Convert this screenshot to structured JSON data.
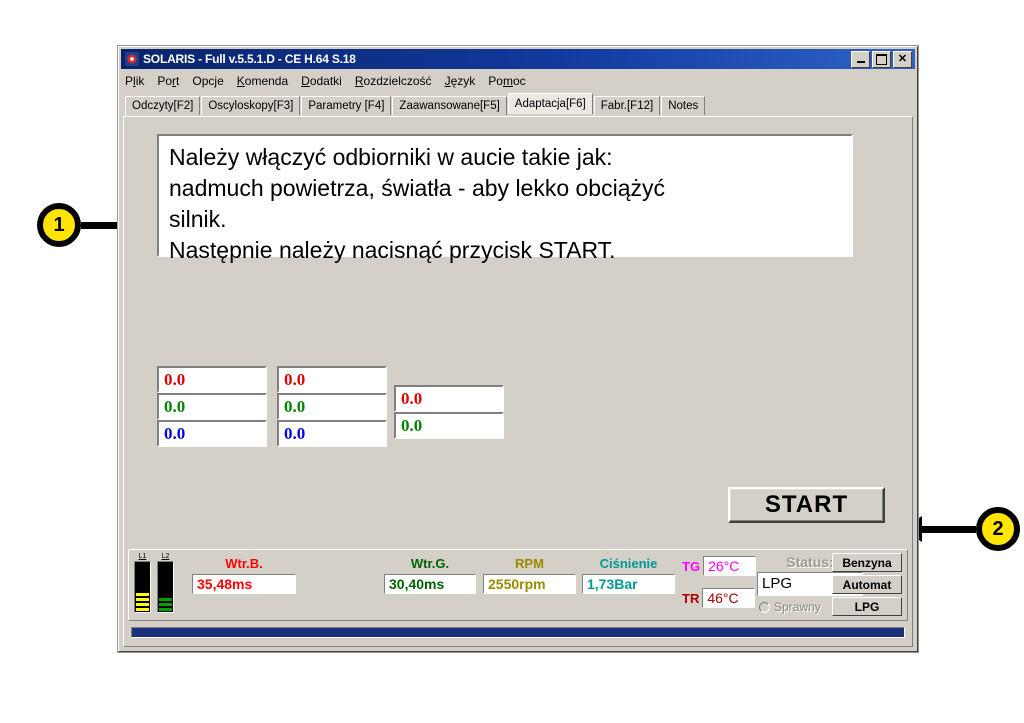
{
  "window": {
    "title": "SOLARIS - Full v.5.5.1.D - CE H.64 S.18",
    "icon": "solaris-app-icon",
    "controls": {
      "minimize": "minimize-icon",
      "maximize": "maximize-icon",
      "close": "close-icon"
    }
  },
  "menu": {
    "items": [
      {
        "pre": "P",
        "accel": "l",
        "post": "ik"
      },
      {
        "pre": "Po",
        "accel": "r",
        "post": "t"
      },
      {
        "pre": "Opc",
        "accel": "j",
        "post": "e"
      },
      {
        "pre": "",
        "accel": "K",
        "post": "omenda"
      },
      {
        "pre": "",
        "accel": "D",
        "post": "odatki"
      },
      {
        "pre": "",
        "accel": "R",
        "post": "ozdzielczość"
      },
      {
        "pre": "",
        "accel": "J",
        "post": "ęzyk"
      },
      {
        "pre": "Po",
        "accel": "m",
        "post": "oc"
      }
    ]
  },
  "tabs": {
    "items": [
      {
        "label": "Odczyty[F2]",
        "active": false
      },
      {
        "label": "Oscyloskopy[F3]",
        "active": false
      },
      {
        "label": "Parametry [F4]",
        "active": false
      },
      {
        "label": "Zaawansowane[F5]",
        "active": false
      },
      {
        "label": "Adaptacja[F6]",
        "active": true
      },
      {
        "label": "Fabr.[F12]",
        "active": false
      },
      {
        "label": "Notes",
        "active": false
      }
    ]
  },
  "instructions": {
    "text": "Należy włączyć odbiorniki w aucie takie jak:\nnadmuch powietrza, światła - aby lekko obciążyć\nsilnik.\nNastępnie należy nacisnąć przycisk START."
  },
  "values": {
    "group_a": [
      {
        "value": "0.0",
        "color": "#e00000"
      },
      {
        "value": "0.0",
        "color": "#008000"
      },
      {
        "value": "0.0",
        "color": "#0000e0"
      }
    ],
    "group_b": [
      {
        "value": "0.0",
        "color": "#e00000"
      },
      {
        "value": "0.0",
        "color": "#008000"
      },
      {
        "value": "0.0",
        "color": "#0000e0"
      }
    ],
    "group_c": [
      {
        "value": "0.0",
        "color": "#e00000"
      },
      {
        "value": "0.0",
        "color": "#008000"
      }
    ]
  },
  "start_button": {
    "label": "START"
  },
  "status_bar": {
    "level_bars": [
      {
        "label": "L1",
        "color": "#ffff00",
        "segments": 4
      },
      {
        "label": "L2",
        "color": "#00a000",
        "segments": 3
      }
    ],
    "readouts": [
      {
        "label": "Wtr.B.",
        "value": "35,48ms",
        "color": "#ff0000"
      },
      {
        "label": "Wtr.G.",
        "value": "30,40ms",
        "color": "#006400"
      },
      {
        "label": "RPM",
        "value": "2550rpm",
        "color": "#9a8b00"
      },
      {
        "label": "Ciśnienie",
        "value": "1,73Bar",
        "color": "#009999"
      }
    ],
    "temperatures": [
      {
        "label": "TG",
        "value": "26°C",
        "color": "#ff00ff"
      },
      {
        "label": "TR",
        "value": "46°C",
        "color": "#aa0000"
      }
    ],
    "status": {
      "caption": "Status:",
      "value": "LPG",
      "radio_label": "Sprawny"
    },
    "mode_buttons": [
      "Benzyna",
      "Automat",
      "LPG"
    ]
  },
  "callouts": [
    {
      "number": "1",
      "direction": "right"
    },
    {
      "number": "2",
      "direction": "left"
    }
  ]
}
